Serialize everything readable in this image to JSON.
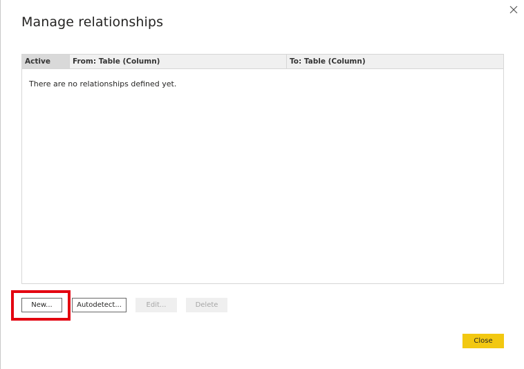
{
  "dialog": {
    "title": "Manage relationships",
    "close_icon": "close-icon"
  },
  "table": {
    "columns": [
      "Active",
      "From: Table (Column)",
      "To: Table (Column)"
    ],
    "empty_message": "There are no relationships defined yet."
  },
  "buttons": {
    "new": "New...",
    "autodetect": "Autodetect...",
    "edit": "Edit...",
    "delete": "Delete",
    "close": "Close"
  },
  "colors": {
    "accent": "#f2c811",
    "highlight": "#e3000f"
  }
}
